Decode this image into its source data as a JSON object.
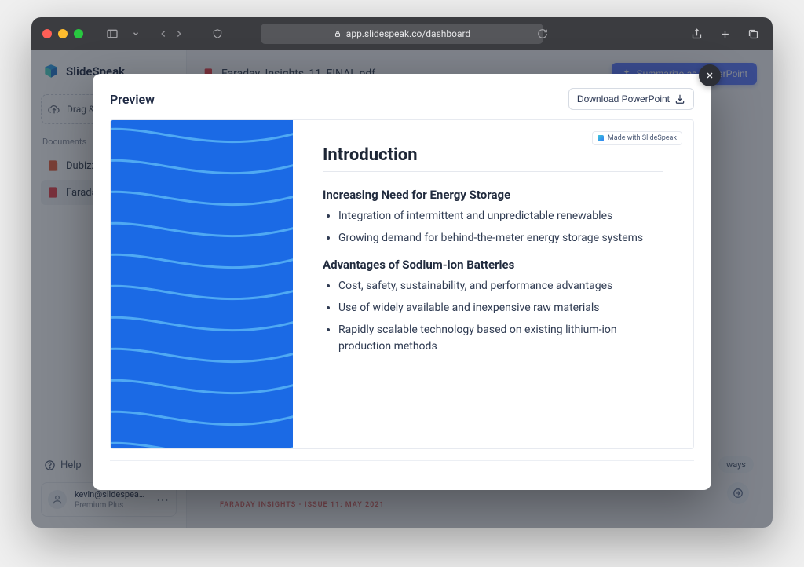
{
  "browser": {
    "url": "app.slidespeak.co/dashboard"
  },
  "app": {
    "brand": "SlideSpeak",
    "dragdrop_label": "Drag & d",
    "documents_label": "Documents",
    "documents": [
      {
        "name": "Dubizzle",
        "kind": "ppt"
      },
      {
        "name": "Faraday_",
        "kind": "pdf"
      }
    ],
    "help_label": "Help",
    "user": {
      "email": "kevin@slidespeak.co",
      "plan": "Premium Plus"
    },
    "doc_header": {
      "filename": "Faraday_Insights_11_FINAL.pdf",
      "summarize_label": "Summarize as PowerPoint"
    },
    "chip": "ways",
    "source_line": "FARADAY INSIGHTS - ISSUE 11: MAY 2021"
  },
  "modal": {
    "title": "Preview",
    "download_label": "Download PowerPoint",
    "badge": "Made with SlideSpeak",
    "slide": {
      "title": "Introduction",
      "sections": [
        {
          "heading": "Increasing Need for Energy Storage",
          "bullets": [
            "Integration of intermittent and unpredictable renewables",
            "Growing demand for behind-the-meter energy storage systems"
          ]
        },
        {
          "heading": "Advantages of Sodium-ion Batteries",
          "bullets": [
            "Cost, safety, sustainability, and performance advantages",
            "Use of widely available and inexpensive raw materials",
            "Rapidly scalable technology based on existing lithium-ion production methods"
          ]
        }
      ]
    }
  }
}
